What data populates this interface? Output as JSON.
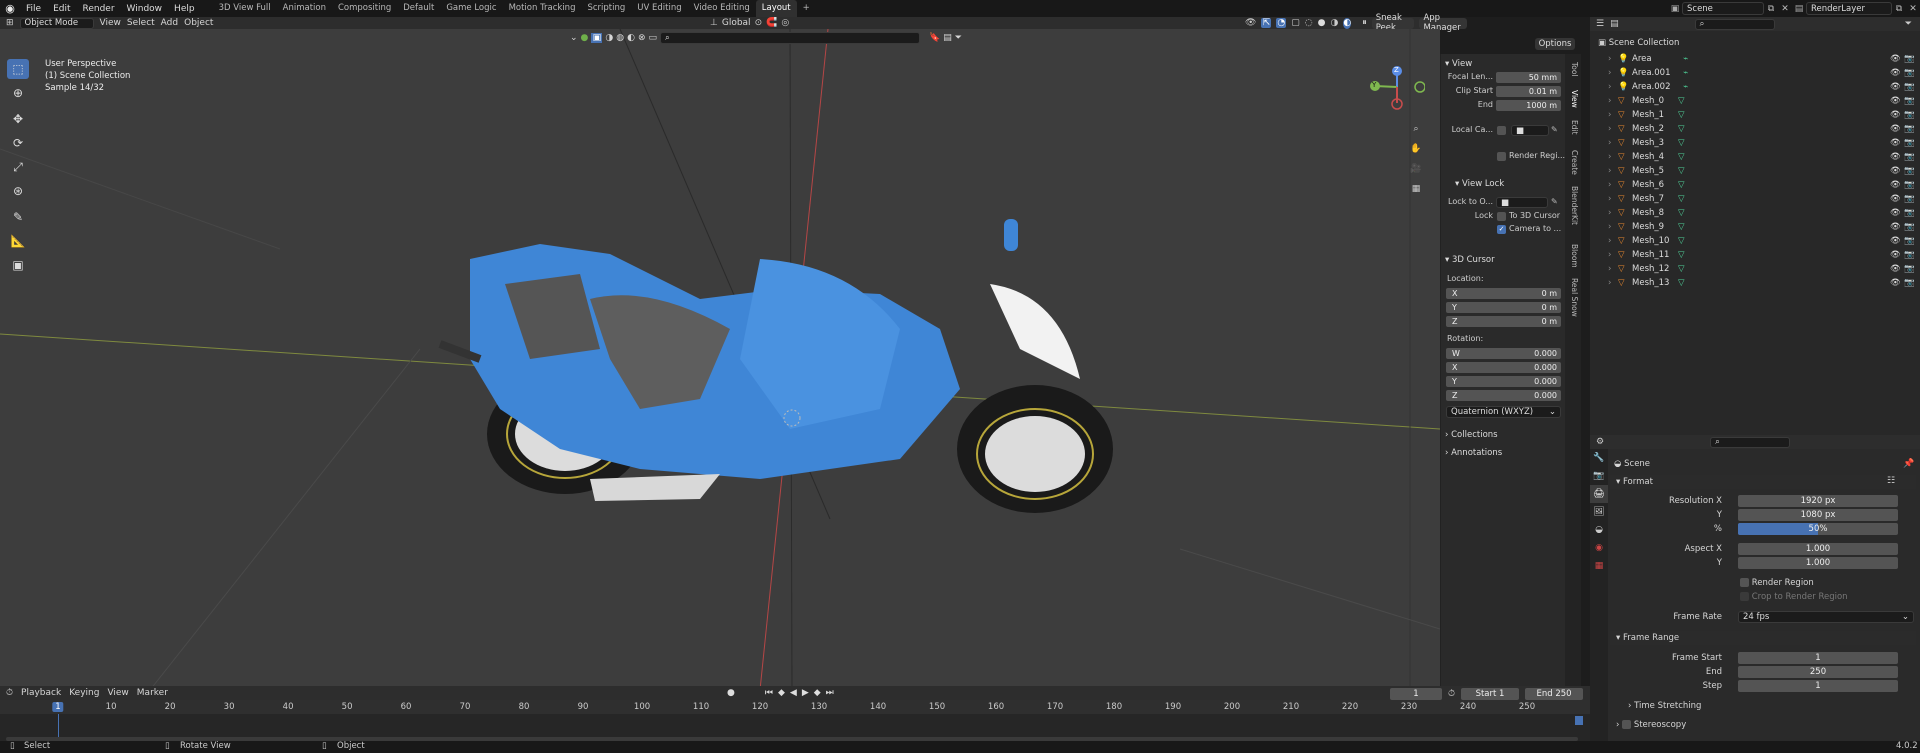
{
  "app": {
    "menus": [
      "File",
      "Edit",
      "Render",
      "Window",
      "Help"
    ],
    "workspaces": [
      "3D View Full",
      "Animation",
      "Compositing",
      "Default",
      "Game Logic",
      "Motion Tracking",
      "Scripting",
      "UV Editing",
      "Video Editing",
      "Layout"
    ],
    "active_workspace": "Layout",
    "plus": "+",
    "scene": "Scene",
    "view_layer": "RenderLayer"
  },
  "viewport_header": {
    "mode": "Object Mode",
    "menus": [
      "View",
      "Select",
      "Add",
      "Object"
    ],
    "orientation": "Global",
    "sneak_peek": "Sneak Peek",
    "app_manager": "App Manager",
    "options": "Options"
  },
  "overlay_text": {
    "line1": "User Perspective",
    "line2": "(1) Scene Collection",
    "line3": "Sample 14/32"
  },
  "gizmo": {
    "x": "X",
    "y": "Y",
    "z": "Z"
  },
  "npanel": {
    "tabs": [
      "Tool",
      "View",
      "Edit",
      "Create",
      "BlenderKit",
      "Bloom",
      "Real Snow"
    ],
    "view_header": "View",
    "focal_label": "Focal Len...",
    "focal_value": "50 mm",
    "clip_start_label": "Clip Start",
    "clip_start_value": "0.01 m",
    "end_label": "End",
    "end_value": "1000 m",
    "local_camera_label": "Local Ca...",
    "render_region_label": "Render Regi...",
    "view_lock_header": "View Lock",
    "lock_to_label": "Lock to O...",
    "lock_label": "Lock",
    "to_3d_cursor": "To 3D Cursor",
    "camera_to": "Camera to ...",
    "cursor_header": "3D Cursor",
    "location_label": "Location:",
    "loc_x": "0 m",
    "loc_y": "0 m",
    "loc_z": "0 m",
    "rotation_label": "Rotation:",
    "rot_w": "0.000",
    "rot_x": "0.000",
    "rot_y": "0.000",
    "rot_z": "0.000",
    "rotation_mode": "Quaternion (WXYZ)",
    "collections": "Collections",
    "annotations": "Annotations",
    "axis_x": "X",
    "axis_y": "Y",
    "axis_z": "Z",
    "axis_w": "W"
  },
  "outliner": {
    "root": "Scene Collection",
    "items": [
      "Area",
      "Area.001",
      "Area.002",
      "Mesh_0",
      "Mesh_1",
      "Mesh_2",
      "Mesh_3",
      "Mesh_4",
      "Mesh_5",
      "Mesh_6",
      "Mesh_7",
      "Mesh_8",
      "Mesh_9",
      "Mesh_10",
      "Mesh_11",
      "Mesh_12",
      "Mesh_13"
    ]
  },
  "properties": {
    "scene_label": "Scene",
    "format_header": "Format",
    "resolution_x_label": "Resolution X",
    "resolution_x": "1920 px",
    "y_label": "Y",
    "resolution_y": "1080 px",
    "percent_label": "%",
    "resolution_percent": "50%",
    "resolution_fill": 0.5,
    "aspect_x_label": "Aspect X",
    "aspect_x": "1.000",
    "aspect_y": "1.000",
    "render_region": "Render Region",
    "crop_region": "Crop to Render Region",
    "frame_rate_label": "Frame Rate",
    "frame_rate": "24 fps",
    "frame_range_header": "Frame Range",
    "frame_start_label": "Frame Start",
    "frame_start": "1",
    "end_label": "End",
    "frame_end": "250",
    "step_label": "Step",
    "step": "1",
    "time_stretching": "Time Stretching",
    "stereoscopy": "Stereoscopy"
  },
  "timeline": {
    "menus": [
      "Playback",
      "Keying",
      "View",
      "Marker"
    ],
    "current_frame": "1",
    "start_label": "Start",
    "start": "1",
    "end_label": "End",
    "end": "250",
    "ticks": [
      "1",
      "10",
      "20",
      "30",
      "40",
      "50",
      "60",
      "70",
      "80",
      "90",
      "100",
      "110",
      "120",
      "130",
      "140",
      "150",
      "160",
      "170",
      "180",
      "190",
      "200",
      "210",
      "220",
      "230",
      "240",
      "250"
    ]
  },
  "statusbar": {
    "select": "Select",
    "rotate": "Rotate View",
    "object": "Object",
    "version": "4.0.2"
  },
  "colors": {
    "accent": "#4772b3",
    "bike_blue": "#3f86d6",
    "viewport_bg": "#3d3d3d"
  }
}
